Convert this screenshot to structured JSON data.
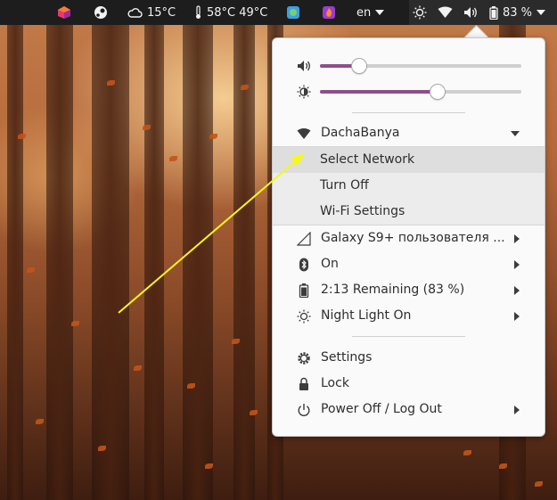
{
  "topbar": {
    "weather": "15°C",
    "temps": "58°C 49°C",
    "language": "en",
    "battery": "83 %"
  },
  "menu": {
    "volume_level": 0.19,
    "brightness_level": 0.58,
    "wifi": {
      "network": "DachaBanya",
      "submenu": [
        "Select Network",
        "Turn Off",
        "Wi-Fi Settings"
      ],
      "hover_index": 0
    },
    "items": [
      {
        "icon": "mobile-signal-icon",
        "label": "Galaxy S9+ пользователя ..."
      },
      {
        "icon": "bluetooth-icon",
        "label": "On"
      },
      {
        "icon": "battery-icon",
        "label": "2:13 Remaining (83 %)"
      },
      {
        "icon": "night-light-icon",
        "label": "Night Light On"
      }
    ],
    "actions": [
      {
        "icon": "settings-icon",
        "label": "Settings"
      },
      {
        "icon": "lock-icon",
        "label": "Lock"
      },
      {
        "icon": "power-icon",
        "label": "Power Off / Log Out"
      }
    ]
  },
  "colors": {
    "accent": "#8f4e8b",
    "annotation": "#f7f71a",
    "panel": "#1d1d1d",
    "menu_bg": "#fafafa"
  }
}
